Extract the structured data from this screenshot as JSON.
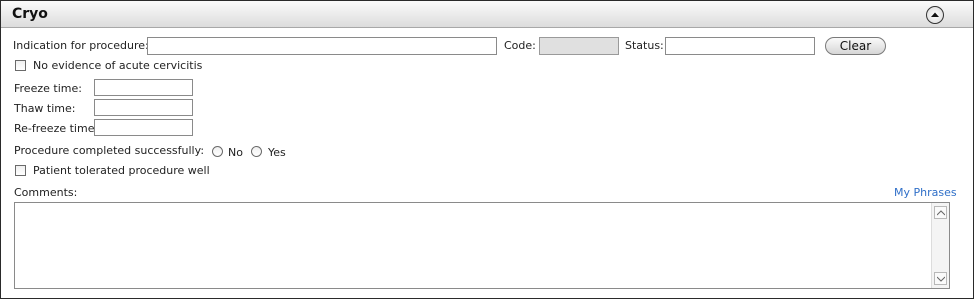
{
  "panel": {
    "title": "Cryo",
    "collapse_icon": "chevron-up-circle-icon"
  },
  "indication": {
    "label": "Indication for procedure:",
    "value": ""
  },
  "code": {
    "label": "Code:",
    "value": ""
  },
  "status": {
    "label": "Status:",
    "value": ""
  },
  "clear_button": {
    "label": "Clear"
  },
  "no_evidence": {
    "label": "No evidence of acute cervicitis",
    "checked": false
  },
  "freeze_time": {
    "label": "Freeze time:",
    "value": ""
  },
  "thaw_time": {
    "label": "Thaw time:",
    "value": ""
  },
  "refreeze_time": {
    "label": "Re-freeze time:",
    "value": ""
  },
  "procedure_completed": {
    "label": "Procedure completed successfully:",
    "options": [
      "No",
      "Yes"
    ],
    "selected": null
  },
  "patient_tolerated": {
    "label": "Patient tolerated procedure well",
    "checked": false
  },
  "comments": {
    "label": "Comments:",
    "value": "",
    "my_phrases_link": "My Phrases"
  },
  "colors": {
    "link": "#2f6fc8",
    "header_gradient_top": "#fbfbfb",
    "header_gradient_bottom": "#dcdcdc",
    "readonly_fill": "#e0e0e0"
  }
}
